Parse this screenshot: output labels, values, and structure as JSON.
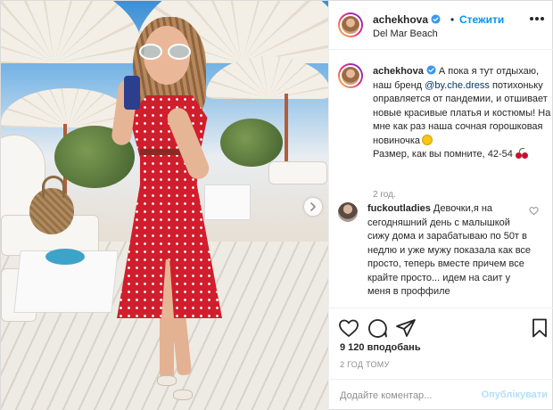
{
  "post": {
    "author": "achekhova",
    "follow_label": "Стежити",
    "dot": "•",
    "location": "Del Mar Beach",
    "caption": {
      "username": "achekhova",
      "text_1": "А пока я тут отдыхаю, наш бренд ",
      "mention": "@by.che.dress",
      "text_2": " потихоньку оправляется от пандемии, и отшивает новые красивые платья и костюмы! На мне как раз наша сочная горошковая новиночка",
      "text_3": "Размер, как вы помните, 42-54",
      "age": "2 год."
    },
    "comment": {
      "username": "fuckoutladies",
      "text": "Девочки,я на сегодняшний день с малышкой сижу дома и зарабатываю по 50т в недлю и уже мужу показала как все просто, теперь вместе причем все крайте просто... идем на саит у меня в проффиле"
    },
    "likes_label": "9 120 вподобань",
    "timestamp": "2 ГОД ТОМУ",
    "add_comment_placeholder": "Додайте коментар...",
    "publish_label": "Опублікувати"
  },
  "icons": {
    "verified": "verified-badge-icon",
    "more": "more-options-icon",
    "like": "heart-icon",
    "comment": "comment-bubble-icon",
    "share": "paper-plane-icon",
    "save": "bookmark-icon",
    "next": "chevron-right-icon"
  },
  "colors": {
    "accent": "#0095f6",
    "verified": "#3897f0",
    "publish_disabled": "#b2dffc",
    "secondary_text": "#8e8e8e",
    "dress": "#d01e2c"
  }
}
